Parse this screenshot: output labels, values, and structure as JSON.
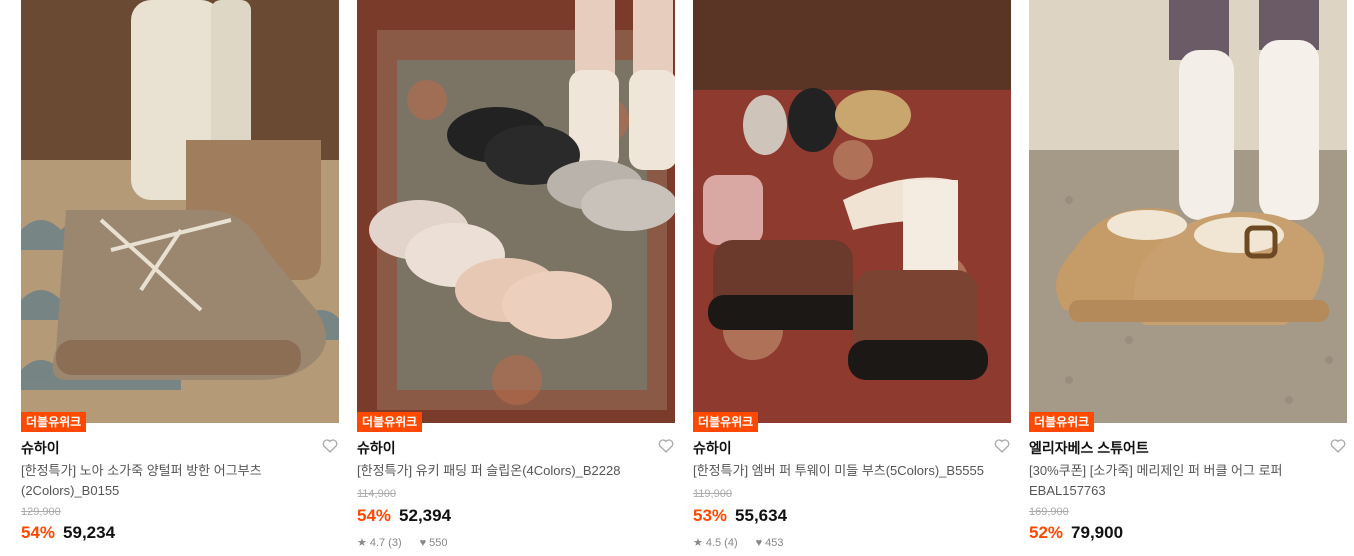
{
  "products": [
    {
      "badge": "더블유위크",
      "brand": "슈하이",
      "name": "[한정특가] 노아 소가죽 양털퍼 방한 어그부츠(2Colors)_B0155",
      "original_price": "129,900",
      "discount": "54%",
      "price": "59,234",
      "rating": "",
      "reviews": "",
      "likes": ""
    },
    {
      "badge": "더블유위크",
      "brand": "슈하이",
      "name": "[한정특가] 유키 패딩 퍼 슬립온(4Colors)_B2228",
      "original_price": "114,900",
      "discount": "54%",
      "price": "52,394",
      "rating": "4.7",
      "reviews": "(3)",
      "likes": "550"
    },
    {
      "badge": "더블유위크",
      "brand": "슈하이",
      "name": "[한정특가] 엠버 퍼 투웨이 미들 부츠(5Colors)_B5555",
      "original_price": "119,900",
      "discount": "53%",
      "price": "55,634",
      "rating": "4.5",
      "reviews": "(4)",
      "likes": "453"
    },
    {
      "badge": "더블유위크",
      "brand": "엘리자베스 스튜어트",
      "name": "[30%쿠폰] [소가죽] 메리제인 퍼 버클 어그 로퍼 EBAL157763",
      "original_price": "169,900",
      "discount": "52%",
      "price": "79,900",
      "rating": "",
      "reviews": "",
      "likes": ""
    }
  ],
  "icons": {
    "wishlist": "heart-outline-icon",
    "rating": "star-icon",
    "likes": "heart-filled-icon"
  },
  "colors": {
    "accent": "#ff4800",
    "badge_bg": "#ff4800"
  }
}
